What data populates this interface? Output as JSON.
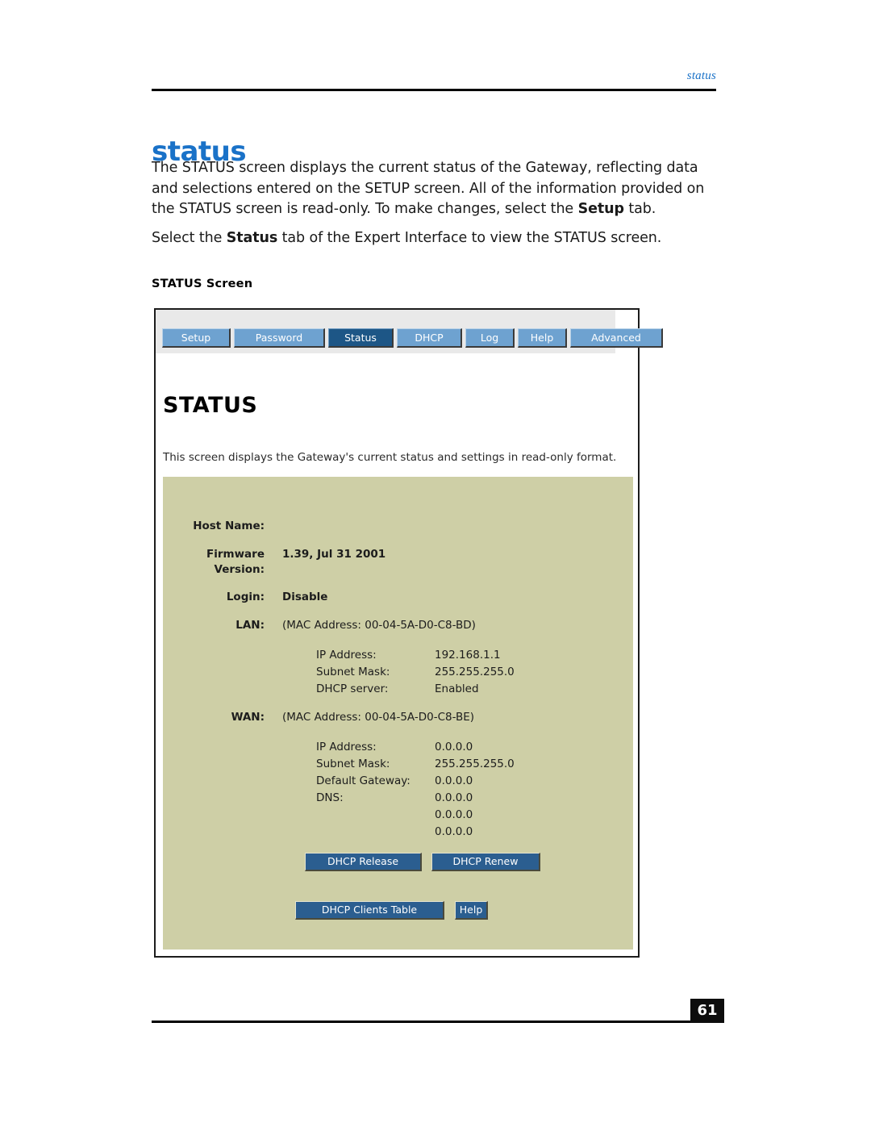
{
  "document": {
    "running_head": "status",
    "page_title": "status",
    "page_number": "61",
    "section_label": "STATUS Screen",
    "paragraphs": [
      "The STATUS screen displays the current status of the Gateway, reflecting data and selections entered on the SETUP screen. All of the information provided on the STATUS screen is read-only. To make changes, select the Setup tab.",
      "Select the Status tab of the Expert Interface to view the STATUS screen."
    ],
    "para1_part1": "The STATUS screen displays the current status of the Gateway, reflecting data and selections entered on the SETUP screen. All of the information provided on the STATUS screen is read-only. To make changes, select the ",
    "para1_bold": "Setup",
    "para1_part2": " tab.",
    "para2_part1": "Select the ",
    "para2_bold": "Status",
    "para2_part2": " tab of the Expert Interface to view the STATUS screen."
  },
  "colors": {
    "accent_blue": "#1a72c8",
    "tab_blue": "#6ea2d0",
    "tab_selected_blue": "#1d5686",
    "panel_tan": "#cecfa6",
    "button_blue": "#2b5e90",
    "toolbar_gray": "#e9e9e9"
  },
  "screenshot": {
    "tabs": [
      {
        "label": "Setup",
        "selected": false
      },
      {
        "label": "Password",
        "selected": false
      },
      {
        "label": "Status",
        "selected": true
      },
      {
        "label": "DHCP",
        "selected": false
      },
      {
        "label": "Log",
        "selected": false
      },
      {
        "label": "Help",
        "selected": false
      },
      {
        "label": "Advanced",
        "selected": false
      }
    ],
    "title": "STATUS",
    "description": "This screen displays the Gateway's current status and settings in read-only format.",
    "fields": {
      "host_name_label": "Host Name:",
      "host_name_value": "",
      "firmware_label_line1": "Firmware",
      "firmware_label_line2": "Version:",
      "firmware_value": "1.39, Jul 31 2001",
      "login_label": "Login:",
      "login_value": "Disable",
      "lan_label": "LAN:",
      "lan_mac": "(MAC Address: 00-04-5A-D0-C8-BD)",
      "wan_label": "WAN:",
      "wan_mac": "(MAC Address: 00-04-5A-D0-C8-BE)"
    },
    "lan_details": [
      {
        "label": "IP Address:",
        "value": "192.168.1.1"
      },
      {
        "label": "Subnet Mask:",
        "value": "255.255.255.0"
      },
      {
        "label": "DHCP server:",
        "value": "Enabled"
      }
    ],
    "wan_details": [
      {
        "label": "IP Address:",
        "value": "0.0.0.0"
      },
      {
        "label": "Subnet Mask:",
        "value": "255.255.255.0"
      },
      {
        "label": "Default Gateway:",
        "value": "0.0.0.0"
      },
      {
        "label": "DNS:",
        "value": "0.0.0.0"
      }
    ],
    "dns_extra": [
      "0.0.0.0",
      "0.0.0.0"
    ],
    "buttons": {
      "dhcp_release": "DHCP Release",
      "dhcp_renew": "DHCP Renew",
      "dhcp_clients_table": "DHCP Clients Table",
      "help": "Help"
    }
  }
}
